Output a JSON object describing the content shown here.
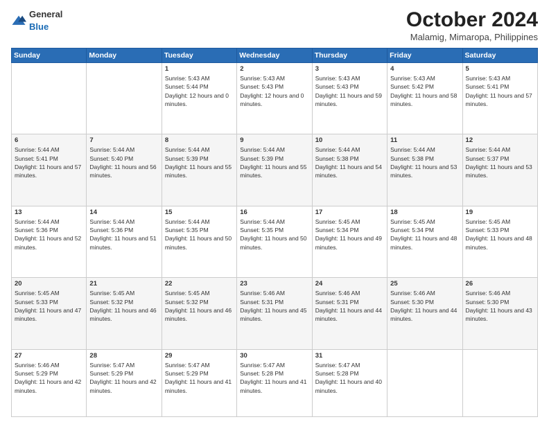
{
  "header": {
    "logo_general": "General",
    "logo_blue": "Blue",
    "month_title": "October 2024",
    "subtitle": "Malamig, Mimaropa, Philippines"
  },
  "days_of_week": [
    "Sunday",
    "Monday",
    "Tuesday",
    "Wednesday",
    "Thursday",
    "Friday",
    "Saturday"
  ],
  "weeks": [
    [
      {
        "day": "",
        "info": ""
      },
      {
        "day": "",
        "info": ""
      },
      {
        "day": "1",
        "info": "Sunrise: 5:43 AM\nSunset: 5:44 PM\nDaylight: 12 hours and 0 minutes."
      },
      {
        "day": "2",
        "info": "Sunrise: 5:43 AM\nSunset: 5:43 PM\nDaylight: 12 hours and 0 minutes."
      },
      {
        "day": "3",
        "info": "Sunrise: 5:43 AM\nSunset: 5:43 PM\nDaylight: 11 hours and 59 minutes."
      },
      {
        "day": "4",
        "info": "Sunrise: 5:43 AM\nSunset: 5:42 PM\nDaylight: 11 hours and 58 minutes."
      },
      {
        "day": "5",
        "info": "Sunrise: 5:43 AM\nSunset: 5:41 PM\nDaylight: 11 hours and 57 minutes."
      }
    ],
    [
      {
        "day": "6",
        "info": "Sunrise: 5:44 AM\nSunset: 5:41 PM\nDaylight: 11 hours and 57 minutes."
      },
      {
        "day": "7",
        "info": "Sunrise: 5:44 AM\nSunset: 5:40 PM\nDaylight: 11 hours and 56 minutes."
      },
      {
        "day": "8",
        "info": "Sunrise: 5:44 AM\nSunset: 5:39 PM\nDaylight: 11 hours and 55 minutes."
      },
      {
        "day": "9",
        "info": "Sunrise: 5:44 AM\nSunset: 5:39 PM\nDaylight: 11 hours and 55 minutes."
      },
      {
        "day": "10",
        "info": "Sunrise: 5:44 AM\nSunset: 5:38 PM\nDaylight: 11 hours and 54 minutes."
      },
      {
        "day": "11",
        "info": "Sunrise: 5:44 AM\nSunset: 5:38 PM\nDaylight: 11 hours and 53 minutes."
      },
      {
        "day": "12",
        "info": "Sunrise: 5:44 AM\nSunset: 5:37 PM\nDaylight: 11 hours and 53 minutes."
      }
    ],
    [
      {
        "day": "13",
        "info": "Sunrise: 5:44 AM\nSunset: 5:36 PM\nDaylight: 11 hours and 52 minutes."
      },
      {
        "day": "14",
        "info": "Sunrise: 5:44 AM\nSunset: 5:36 PM\nDaylight: 11 hours and 51 minutes."
      },
      {
        "day": "15",
        "info": "Sunrise: 5:44 AM\nSunset: 5:35 PM\nDaylight: 11 hours and 50 minutes."
      },
      {
        "day": "16",
        "info": "Sunrise: 5:44 AM\nSunset: 5:35 PM\nDaylight: 11 hours and 50 minutes."
      },
      {
        "day": "17",
        "info": "Sunrise: 5:45 AM\nSunset: 5:34 PM\nDaylight: 11 hours and 49 minutes."
      },
      {
        "day": "18",
        "info": "Sunrise: 5:45 AM\nSunset: 5:34 PM\nDaylight: 11 hours and 48 minutes."
      },
      {
        "day": "19",
        "info": "Sunrise: 5:45 AM\nSunset: 5:33 PM\nDaylight: 11 hours and 48 minutes."
      }
    ],
    [
      {
        "day": "20",
        "info": "Sunrise: 5:45 AM\nSunset: 5:33 PM\nDaylight: 11 hours and 47 minutes."
      },
      {
        "day": "21",
        "info": "Sunrise: 5:45 AM\nSunset: 5:32 PM\nDaylight: 11 hours and 46 minutes."
      },
      {
        "day": "22",
        "info": "Sunrise: 5:45 AM\nSunset: 5:32 PM\nDaylight: 11 hours and 46 minutes."
      },
      {
        "day": "23",
        "info": "Sunrise: 5:46 AM\nSunset: 5:31 PM\nDaylight: 11 hours and 45 minutes."
      },
      {
        "day": "24",
        "info": "Sunrise: 5:46 AM\nSunset: 5:31 PM\nDaylight: 11 hours and 44 minutes."
      },
      {
        "day": "25",
        "info": "Sunrise: 5:46 AM\nSunset: 5:30 PM\nDaylight: 11 hours and 44 minutes."
      },
      {
        "day": "26",
        "info": "Sunrise: 5:46 AM\nSunset: 5:30 PM\nDaylight: 11 hours and 43 minutes."
      }
    ],
    [
      {
        "day": "27",
        "info": "Sunrise: 5:46 AM\nSunset: 5:29 PM\nDaylight: 11 hours and 42 minutes."
      },
      {
        "day": "28",
        "info": "Sunrise: 5:47 AM\nSunset: 5:29 PM\nDaylight: 11 hours and 42 minutes."
      },
      {
        "day": "29",
        "info": "Sunrise: 5:47 AM\nSunset: 5:29 PM\nDaylight: 11 hours and 41 minutes."
      },
      {
        "day": "30",
        "info": "Sunrise: 5:47 AM\nSunset: 5:28 PM\nDaylight: 11 hours and 41 minutes."
      },
      {
        "day": "31",
        "info": "Sunrise: 5:47 AM\nSunset: 5:28 PM\nDaylight: 11 hours and 40 minutes."
      },
      {
        "day": "",
        "info": ""
      },
      {
        "day": "",
        "info": ""
      }
    ]
  ]
}
